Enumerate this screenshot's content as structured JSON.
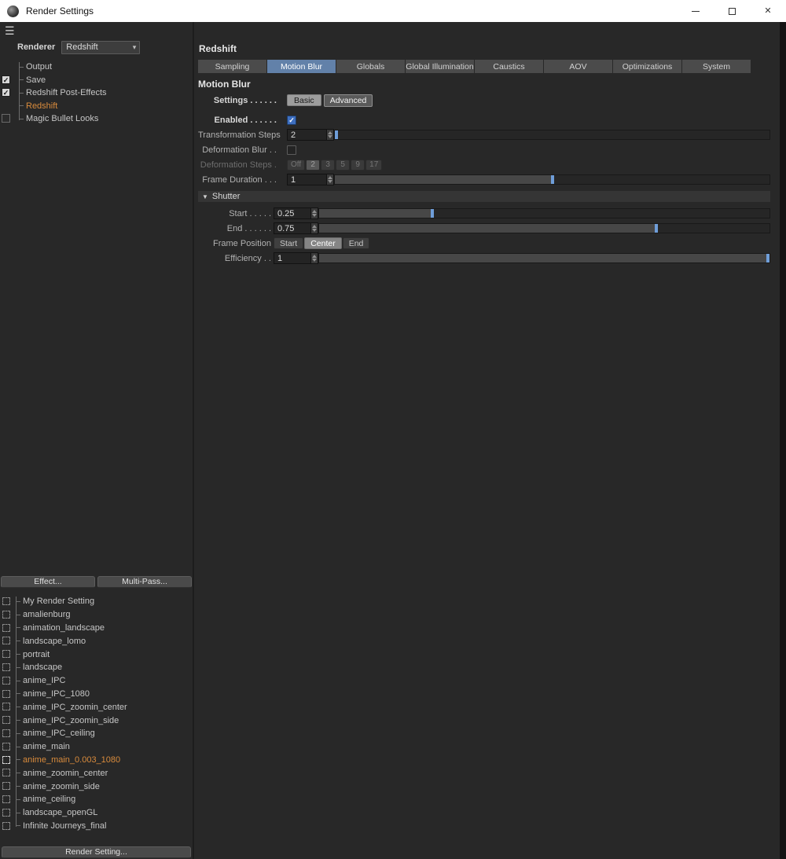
{
  "window": {
    "title": "Render Settings"
  },
  "icons": {
    "hamburger": "☰",
    "check": "✓",
    "close": "✕",
    "dropdown": "▾",
    "collapse": "▼"
  },
  "left": {
    "renderer_label": "Renderer",
    "renderer_value": "Redshift",
    "tree": [
      {
        "label": "Output",
        "checkbox": "none",
        "selected": false
      },
      {
        "label": "Save",
        "checkbox": "checked",
        "selected": false
      },
      {
        "label": "Redshift Post-Effects",
        "checkbox": "checked",
        "selected": false
      },
      {
        "label": "Redshift",
        "checkbox": "none",
        "selected": true
      },
      {
        "label": "Magic Bullet Looks",
        "checkbox": "unchecked",
        "selected": false
      }
    ],
    "effect_button": "Effect...",
    "multipass_button": "Multi-Pass...",
    "presets": [
      {
        "label": "My Render Setting",
        "active": false
      },
      {
        "label": "amalienburg",
        "active": false
      },
      {
        "label": "animation_landscape",
        "active": false
      },
      {
        "label": "landscape_lomo",
        "active": false
      },
      {
        "label": "portrait",
        "active": false
      },
      {
        "label": "landscape",
        "active": false
      },
      {
        "label": "anime_IPC",
        "active": false
      },
      {
        "label": "anime_IPC_1080",
        "active": false
      },
      {
        "label": "anime_IPC_zoomin_center",
        "active": false
      },
      {
        "label": "anime_IPC_zoomin_side",
        "active": false
      },
      {
        "label": "anime_IPC_ceiling",
        "active": false
      },
      {
        "label": "anime_main",
        "active": false
      },
      {
        "label": "anime_main_0.003_1080",
        "active": true
      },
      {
        "label": "anime_zoomin_center",
        "active": false
      },
      {
        "label": "anime_zoomin_side",
        "active": false
      },
      {
        "label": "anime_ceiling",
        "active": false
      },
      {
        "label": "landscape_openGL",
        "active": false
      },
      {
        "label": "Infinite Journeys_final",
        "active": false
      }
    ],
    "render_setting_button": "Render Setting..."
  },
  "main": {
    "header": "Redshift",
    "tabs": [
      "Sampling",
      "Motion Blur",
      "Globals",
      "Global Illumination",
      "Caustics",
      "AOV",
      "Optimizations",
      "System"
    ],
    "active_tab": "Motion Blur",
    "section_title": "Motion Blur",
    "settings": {
      "label": "Settings . . . . . .",
      "options": [
        "Basic",
        "Advanced"
      ],
      "selected": "Advanced"
    },
    "enabled": {
      "label": "Enabled . . . . . .",
      "checked": true
    },
    "transformation_steps": {
      "label": "Transformation Steps",
      "value": "2",
      "slider_percent": 0
    },
    "deformation_blur": {
      "label": "Deformation Blur . .",
      "checked": false
    },
    "deformation_steps": {
      "label": "Deformation Steps .",
      "options": [
        "Off",
        "2",
        "3",
        "5",
        "9",
        "17"
      ],
      "selected": "2",
      "enabled": false
    },
    "frame_duration": {
      "label": "Frame Duration . . .",
      "value": "1",
      "slider_percent": 50
    },
    "shutter": {
      "title": "Shutter",
      "start": {
        "label": "Start . . . . .",
        "value": "0.25",
        "slider_percent": 25
      },
      "end": {
        "label": "End . . . . . .",
        "value": "0.75",
        "slider_percent": 75
      },
      "frame_position": {
        "label": "Frame Position",
        "options": [
          "Start",
          "Center",
          "End"
        ],
        "selected": "Center"
      },
      "efficiency": {
        "label": "Efficiency . .",
        "value": "1",
        "slider_percent": 100
      }
    }
  }
}
